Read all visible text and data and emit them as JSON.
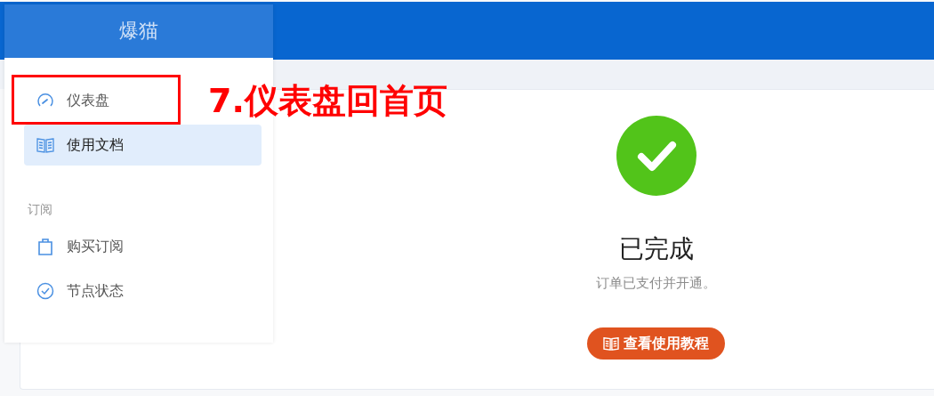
{
  "sidebar": {
    "title": "爆猫",
    "items": [
      {
        "kind": "gauge",
        "label": "仪表盘",
        "selected": false,
        "highlighted": true
      },
      {
        "kind": "book",
        "label": "使用文档",
        "selected": true,
        "highlighted": false
      },
      {
        "kind": "section",
        "label": "订阅"
      },
      {
        "kind": "bag",
        "label": "购买订阅",
        "selected": false,
        "highlighted": false
      },
      {
        "kind": "check",
        "label": "节点状态",
        "selected": false,
        "highlighted": false
      }
    ]
  },
  "annotation": {
    "text": "7.仪表盘回首页"
  },
  "result": {
    "title": "已完成",
    "subtitle": "订单已支付并开通。",
    "button": "查看使用教程"
  }
}
